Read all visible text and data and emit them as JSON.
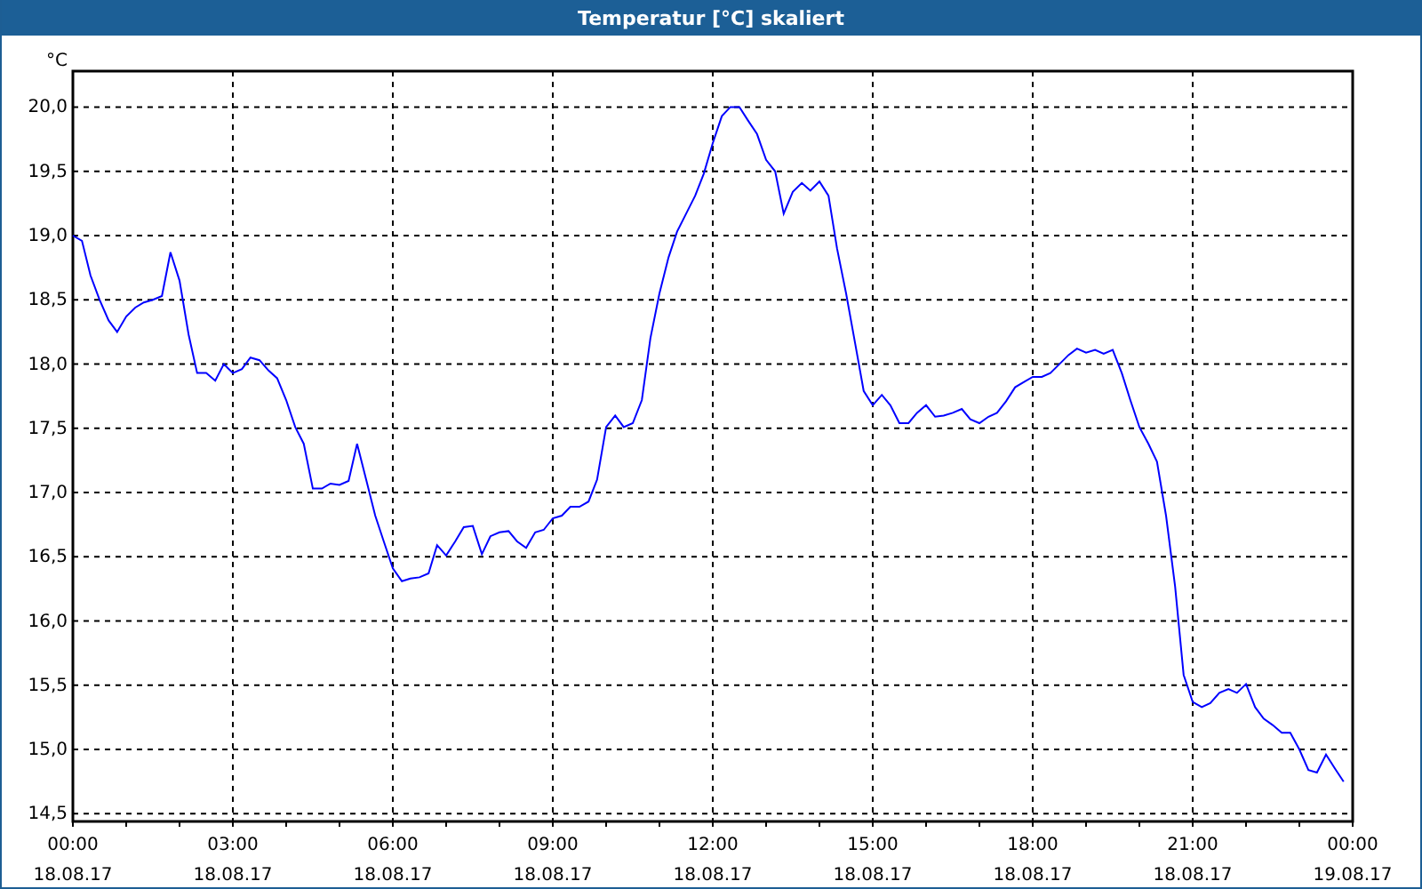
{
  "chart_data": {
    "type": "line",
    "grid": true,
    "title": "Temperatur [°C] skaliert",
    "ylabel": "°C",
    "xlim": [
      0,
      24
    ],
    "ylim": [
      14.44,
      20.28
    ],
    "xticks": [
      {
        "value": 0,
        "label": "00:00"
      },
      {
        "value": 3,
        "label": "03:00"
      },
      {
        "value": 6,
        "label": "06:00"
      },
      {
        "value": 9,
        "label": "09:00"
      },
      {
        "value": 12,
        "label": "12:00"
      },
      {
        "value": 15,
        "label": "15:00"
      },
      {
        "value": 18,
        "label": "18:00"
      },
      {
        "value": 21,
        "label": "21:00"
      },
      {
        "value": 24,
        "label": "00:00"
      }
    ],
    "yticks": [
      {
        "value": 14.5,
        "label": "14,5"
      },
      {
        "value": 15,
        "label": "15,0"
      },
      {
        "value": 15.5,
        "label": "15,5"
      },
      {
        "value": 16,
        "label": "16,0"
      },
      {
        "value": 16.5,
        "label": "16,5"
      },
      {
        "value": 17,
        "label": "17,0"
      },
      {
        "value": 17.5,
        "label": "17,5"
      },
      {
        "value": 18,
        "label": "18,0"
      },
      {
        "value": 18.5,
        "label": "18,5"
      },
      {
        "value": 19,
        "label": "19,0"
      },
      {
        "value": 19.5,
        "label": "19,5"
      },
      {
        "value": 20,
        "label": "20,0"
      }
    ],
    "x": [
      0,
      0.17,
      0.33,
      0.5,
      0.67,
      0.83,
      1,
      1.17,
      1.33,
      1.5,
      1.67,
      1.83,
      2,
      2.17,
      2.33,
      2.5,
      2.67,
      2.83,
      3,
      3.17,
      3.33,
      3.5,
      3.67,
      3.83,
      4,
      4.17,
      4.33,
      4.5,
      4.67,
      4.83,
      5,
      5.17,
      5.33,
      5.5,
      5.67,
      5.83,
      6,
      6.17,
      6.33,
      6.5,
      6.67,
      6.83,
      7,
      7.17,
      7.33,
      7.5,
      7.67,
      7.83,
      8,
      8.17,
      8.33,
      8.5,
      8.67,
      8.83,
      9,
      9.17,
      9.33,
      9.5,
      9.67,
      9.83,
      10,
      10.17,
      10.33,
      10.5,
      10.67,
      10.83,
      11,
      11.17,
      11.33,
      11.5,
      11.67,
      11.83,
      12,
      12.17,
      12.33,
      12.5,
      12.67,
      12.83,
      13,
      13.17,
      13.33,
      13.5,
      13.67,
      13.83,
      14,
      14.17,
      14.33,
      14.5,
      14.67,
      14.83,
      15,
      15.17,
      15.33,
      15.5,
      15.67,
      15.83,
      16,
      16.17,
      16.33,
      16.5,
      16.67,
      16.83,
      17,
      17.17,
      17.33,
      17.5,
      17.67,
      17.83,
      18,
      18.17,
      18.33,
      18.5,
      18.67,
      18.83,
      19,
      19.17,
      19.33,
      19.5,
      19.67,
      19.83,
      20,
      20.17,
      20.33,
      20.5,
      20.67,
      20.83,
      21,
      21.17,
      21.33,
      21.5,
      21.67,
      21.83,
      22,
      22.17,
      22.33,
      22.5,
      22.67,
      22.83,
      23,
      23.17,
      23.33,
      23.5,
      23.67,
      23.83
    ],
    "series": [
      {
        "color": "#0000ff",
        "values": [
          19.0,
          18.96,
          18.69,
          18.5,
          18.34,
          18.25,
          18.37,
          18.44,
          18.48,
          18.5,
          18.53,
          18.87,
          18.65,
          18.23,
          17.93,
          17.93,
          17.87,
          18.0,
          17.93,
          17.96,
          18.05,
          18.03,
          17.95,
          17.89,
          17.72,
          17.51,
          17.38,
          17.03,
          17.03,
          17.07,
          17.06,
          17.09,
          17.38,
          17.1,
          16.82,
          16.62,
          16.41,
          16.31,
          16.33,
          16.34,
          16.37,
          16.59,
          16.51,
          16.62,
          16.73,
          16.74,
          16.52,
          16.66,
          16.69,
          16.7,
          16.62,
          16.57,
          16.69,
          16.71,
          16.8,
          16.82,
          16.89,
          16.89,
          16.93,
          17.1,
          17.51,
          17.6,
          17.51,
          17.54,
          17.72,
          18.2,
          18.55,
          18.83,
          19.03,
          19.17,
          19.31,
          19.48,
          19.72,
          19.93,
          20.0,
          20.0,
          19.89,
          19.79,
          19.59,
          19.5,
          19.17,
          19.34,
          19.41,
          19.35,
          19.42,
          19.31,
          18.9,
          18.55,
          18.16,
          17.79,
          17.68,
          17.76,
          17.68,
          17.54,
          17.54,
          17.62,
          17.68,
          17.59,
          17.6,
          17.62,
          17.65,
          17.57,
          17.54,
          17.59,
          17.62,
          17.71,
          17.82,
          17.86,
          17.9,
          17.9,
          17.93,
          18.0,
          18.07,
          18.12,
          18.09,
          18.11,
          18.08,
          18.11,
          17.93,
          17.72,
          17.51,
          17.38,
          17.24,
          16.82,
          16.27,
          15.58,
          15.37,
          15.33,
          15.36,
          15.44,
          15.47,
          15.44,
          15.51,
          15.33,
          15.24,
          15.19,
          15.13,
          15.13,
          15.0,
          14.84,
          14.82,
          14.96,
          14.85,
          14.75
        ]
      }
    ]
  },
  "x_tick_dates": [
    "18.08.17",
    "18.08.17",
    "18.08.17",
    "18.08.17",
    "18.08.17",
    "18.08.17",
    "18.08.17",
    "18.08.17",
    "19.08.17"
  ]
}
